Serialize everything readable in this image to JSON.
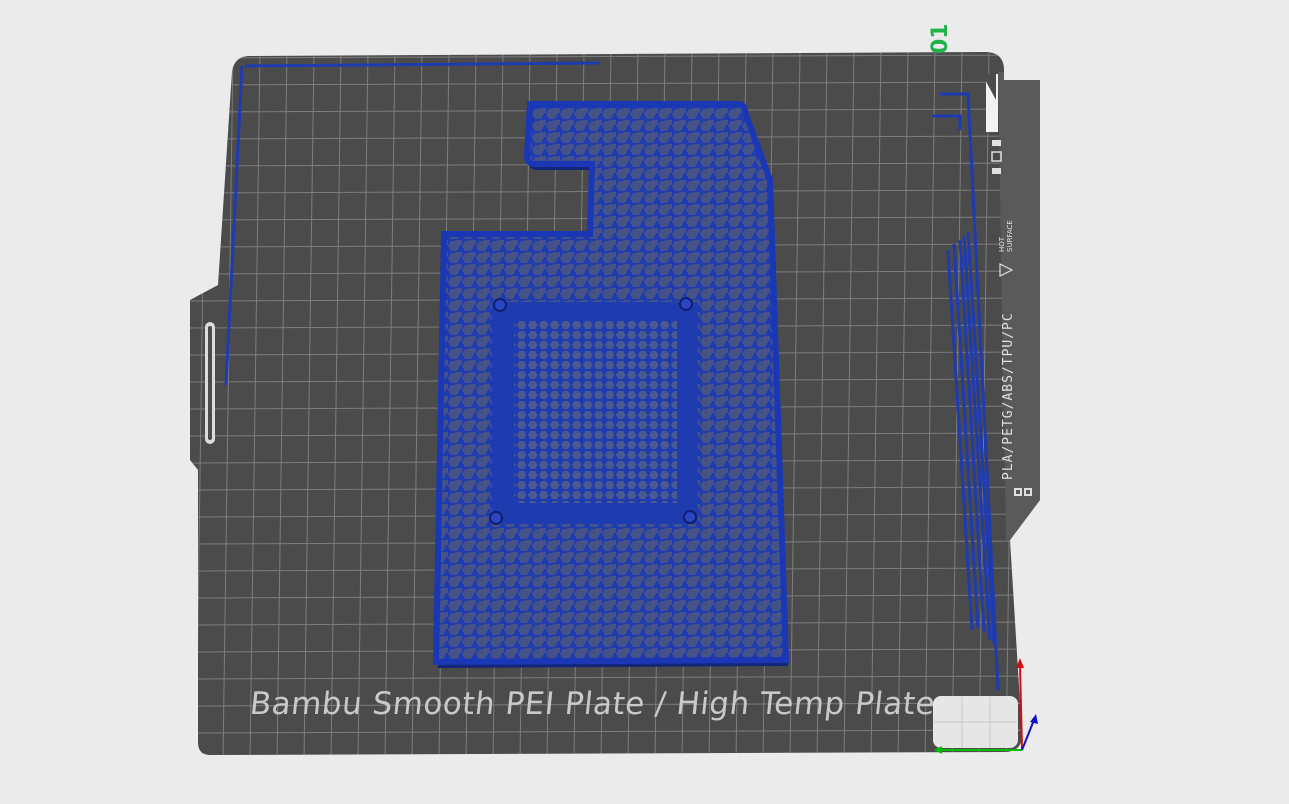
{
  "plate": {
    "label": "Bambu Smooth PEI Plate / High Temp Plate",
    "number": "01",
    "filament_types": "PLA/PETG/ABS/TPU/PC",
    "warning": "HOT SURFACE",
    "warning_line1": "HOT",
    "warning_line2": "SURFACE"
  },
  "colors": {
    "background": "#ebebeb",
    "plate": "#4b4b4b",
    "grid": "#7d7d7d",
    "model": "#1e3bb0",
    "plate_number": "#1fb34a",
    "axis_x": "#00c000",
    "axis_y": "#d01010",
    "axis_z": "#1010c0"
  },
  "icons": [
    "warning-triangle-icon",
    "bambu-logo-icon",
    "axis-gizmo-icon"
  ]
}
